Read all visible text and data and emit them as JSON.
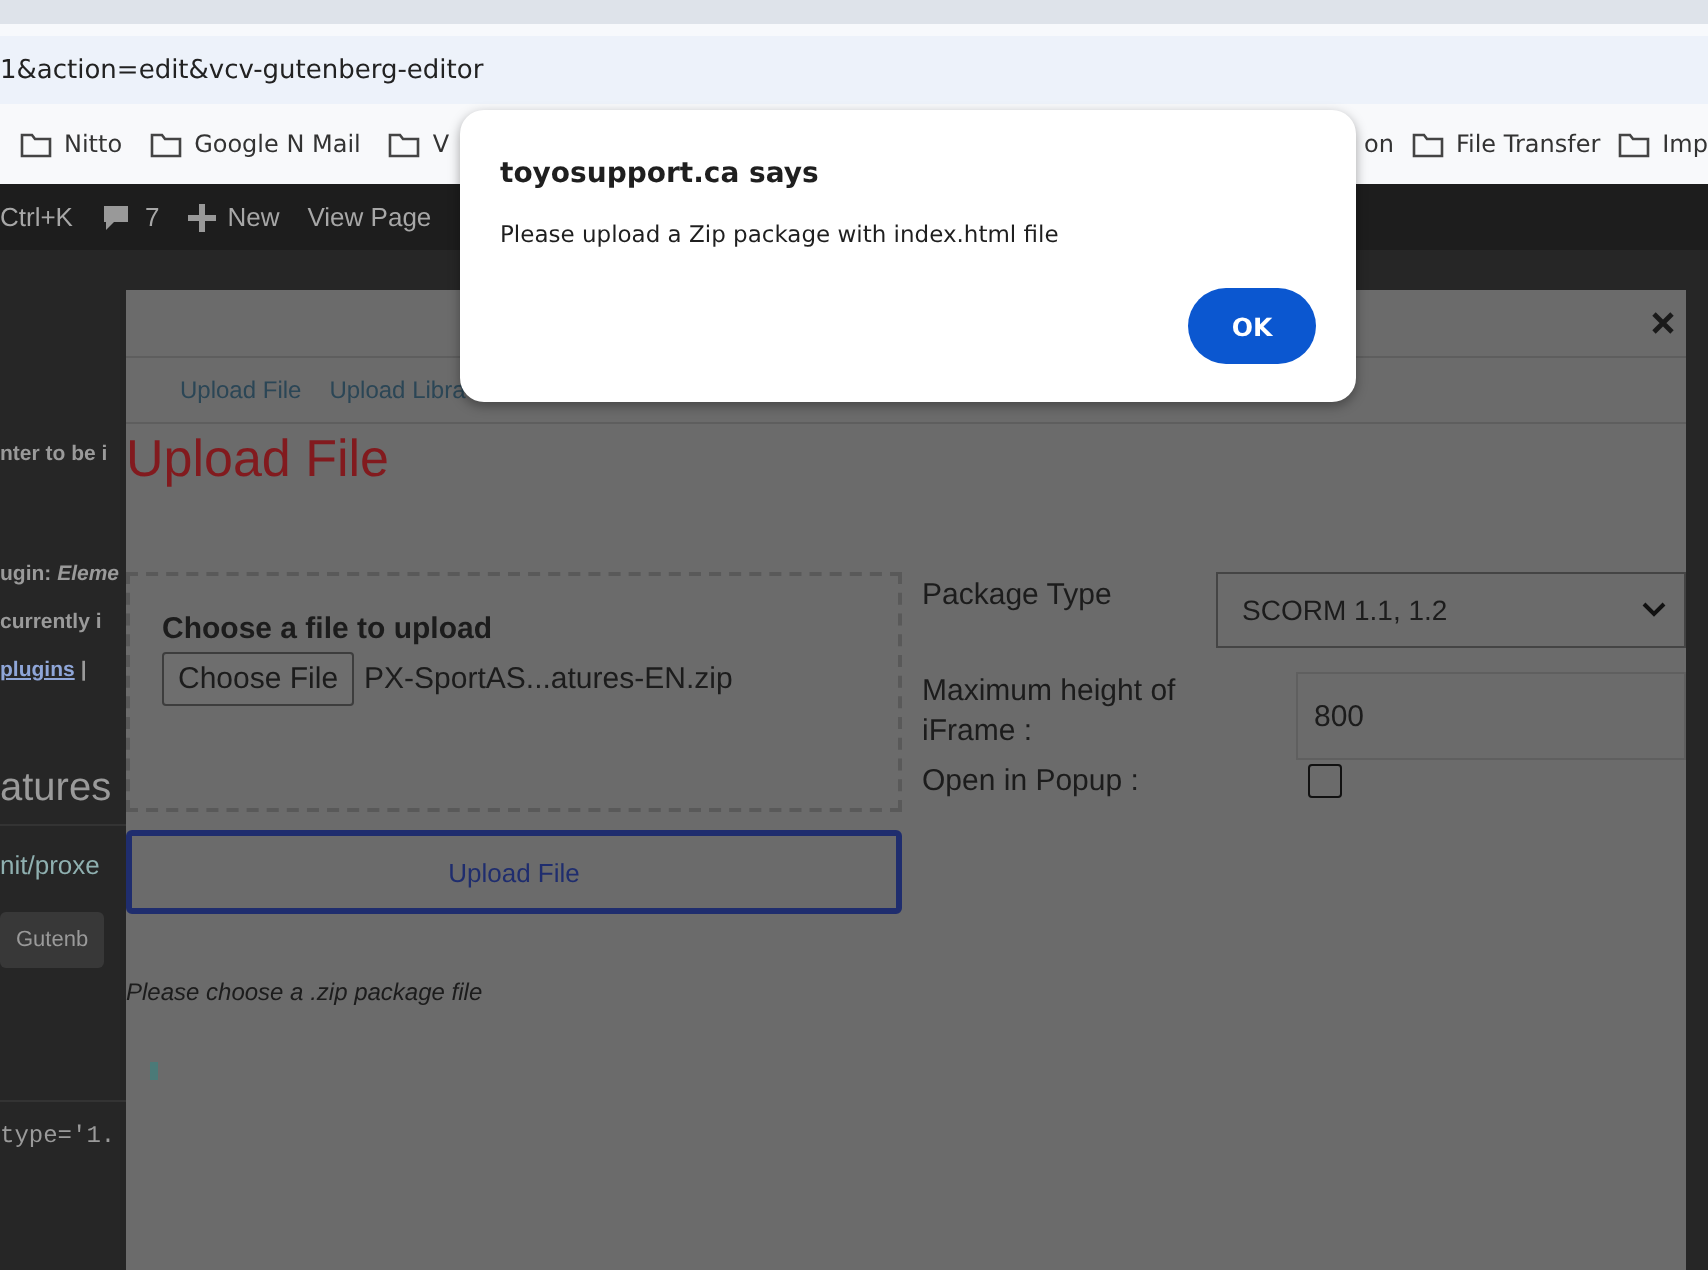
{
  "browser": {
    "address": "1&action=edit&vcv-gutenberg-editor",
    "bookmarks_left": [
      {
        "label": "Nitto"
      },
      {
        "label": "Google N Mail"
      },
      {
        "label": "V"
      }
    ],
    "bookmarks_right": [
      {
        "label": "on"
      },
      {
        "label": "File Transfer"
      },
      {
        "label": "Imp"
      }
    ]
  },
  "admin_bar": {
    "shortcut": "Ctrl+K",
    "comments": "7",
    "new": "New",
    "view_page": "View Page"
  },
  "background_page": {
    "lines": [
      {
        "kind": "bold",
        "text": "nter to be i"
      },
      {
        "kind": "bold",
        "text": "ugin: *Eleme*"
      },
      {
        "kind": "bold",
        "text": "currently i"
      },
      {
        "kind": "link",
        "text": "plugins",
        "after": "|"
      },
      {
        "kind": "heading",
        "text": "atures"
      },
      {
        "kind": "path",
        "text": "nit/proxe"
      },
      {
        "kind": "button",
        "text": "Gutenb"
      },
      {
        "kind": "code",
        "text": "type='1."
      }
    ]
  },
  "modal": {
    "tabs": [
      {
        "label": "Upload File"
      },
      {
        "label": "Upload Libra"
      }
    ],
    "title": "Upload File",
    "file_box": {
      "label": "Choose a file to upload",
      "button": "Choose File",
      "file_name": "PX-SportAS...atures-EN.zip"
    },
    "package_type": {
      "label": "Package Type",
      "value": "SCORM 1.1, 1.2"
    },
    "max_height": {
      "label": "Maximum height of iFrame :",
      "value": "800"
    },
    "popup": {
      "label": "Open in Popup :",
      "checked": false
    },
    "upload_button": "Upload File",
    "note": "Please choose a .zip package file"
  },
  "alert": {
    "title": "toyosupport.ca says",
    "message": "Please upload a Zip package with index.html file",
    "button": "OK"
  }
}
